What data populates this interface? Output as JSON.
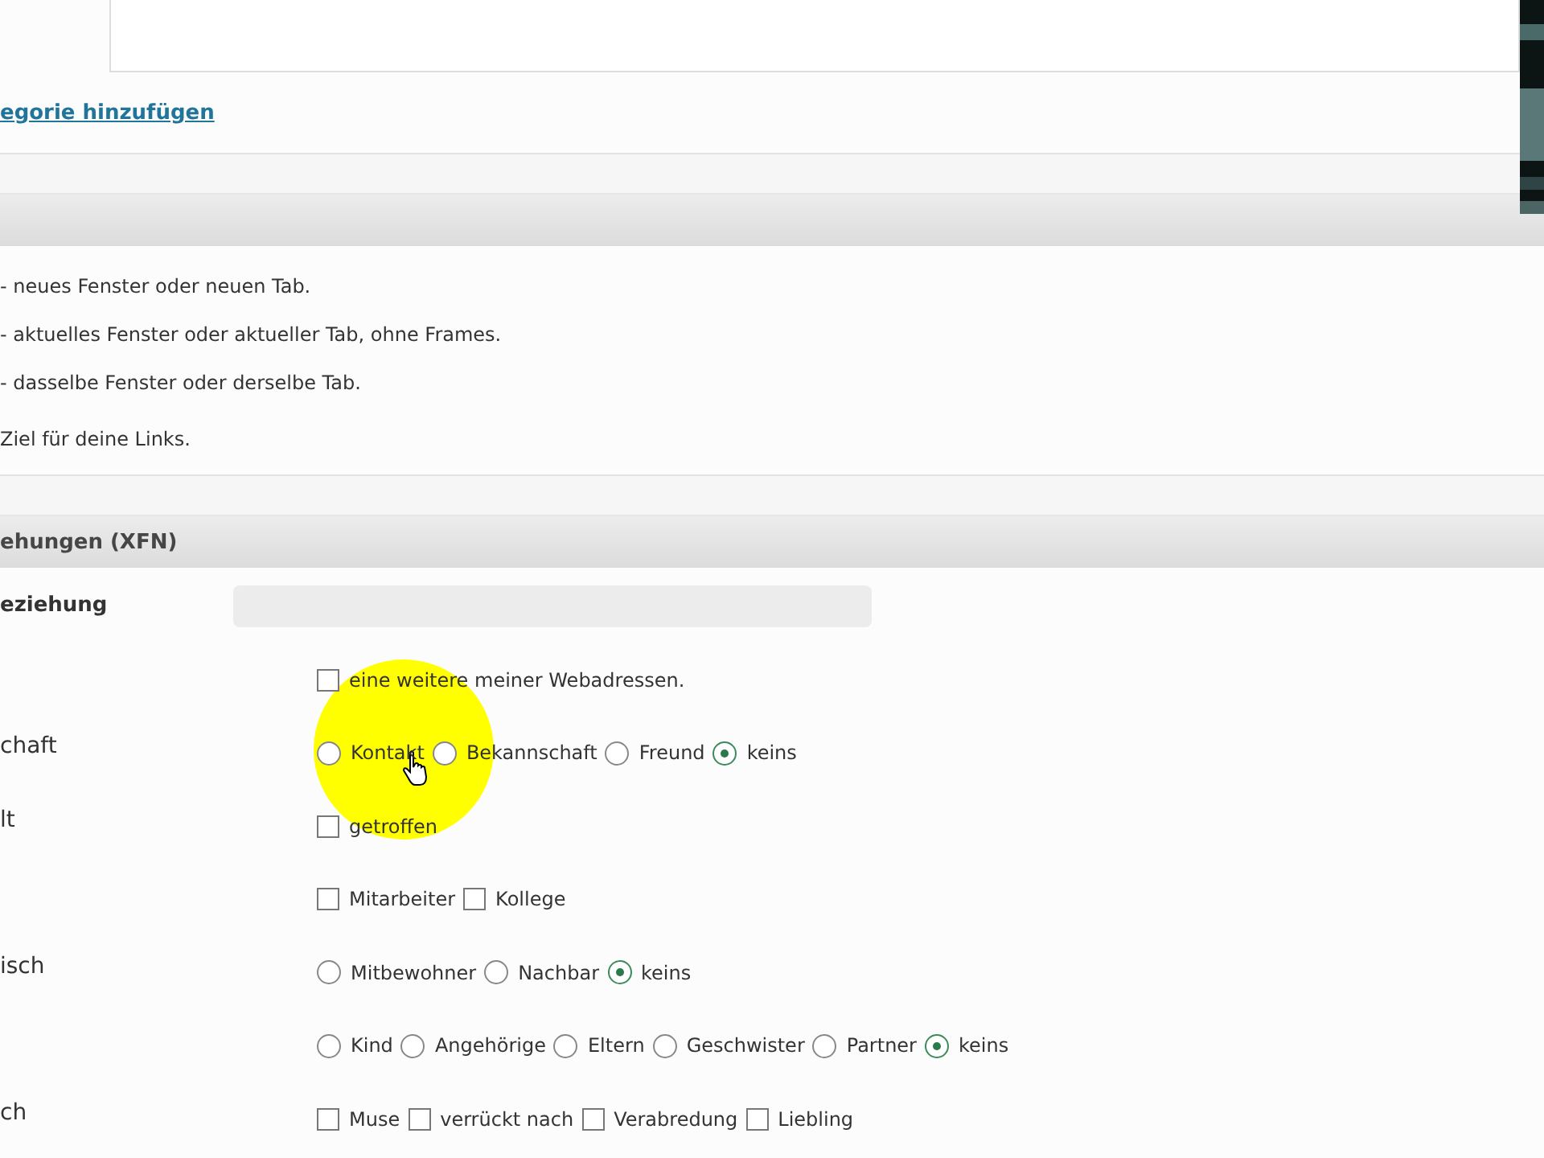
{
  "category_link": "egorie hinzufügen",
  "target_section": {
    "lines": [
      "- neues Fenster oder neuen Tab.",
      "- aktuelles Fenster oder aktueller Tab, ohne Frames.",
      "- dasselbe Fenster oder derselbe Tab."
    ],
    "hint": "Ziel für deine Links."
  },
  "xfn_section": {
    "title": "ehungen (XFN)",
    "field_label": "eziehung",
    "rows": [
      {
        "label": "",
        "kind": "checkbox",
        "options": [
          {
            "label": "eine weitere meiner Webadressen.",
            "checked": false
          }
        ]
      },
      {
        "label": "chaft",
        "kind": "radio",
        "options": [
          {
            "label": "Kontakt",
            "selected": false
          },
          {
            "label": "Bekannschaft",
            "selected": false
          },
          {
            "label": "Freund",
            "selected": false
          },
          {
            "label": "keins",
            "selected": true
          }
        ]
      },
      {
        "label": "lt",
        "kind": "checkbox",
        "options": [
          {
            "label": "getroffen",
            "checked": false
          }
        ]
      },
      {
        "label": "",
        "kind": "checkbox",
        "options": [
          {
            "label": "Mitarbeiter",
            "checked": false
          },
          {
            "label": "Kollege",
            "checked": false
          }
        ]
      },
      {
        "label": "isch",
        "kind": "radio",
        "options": [
          {
            "label": "Mitbewohner",
            "selected": false
          },
          {
            "label": "Nachbar",
            "selected": false
          },
          {
            "label": "keins",
            "selected": true
          }
        ]
      },
      {
        "label": "",
        "kind": "radio",
        "options": [
          {
            "label": "Kind",
            "selected": false
          },
          {
            "label": "Angehörige",
            "selected": false
          },
          {
            "label": "Eltern",
            "selected": false
          },
          {
            "label": "Geschwister",
            "selected": false
          },
          {
            "label": "Partner",
            "selected": false
          },
          {
            "label": "keins",
            "selected": true
          }
        ]
      },
      {
        "label": "ch",
        "kind": "checkbox",
        "options": [
          {
            "label": "Muse",
            "checked": false
          },
          {
            "label": "verrückt nach",
            "checked": false
          },
          {
            "label": "Verabredung",
            "checked": false
          },
          {
            "label": "Liebling",
            "checked": false
          }
        ]
      }
    ]
  }
}
